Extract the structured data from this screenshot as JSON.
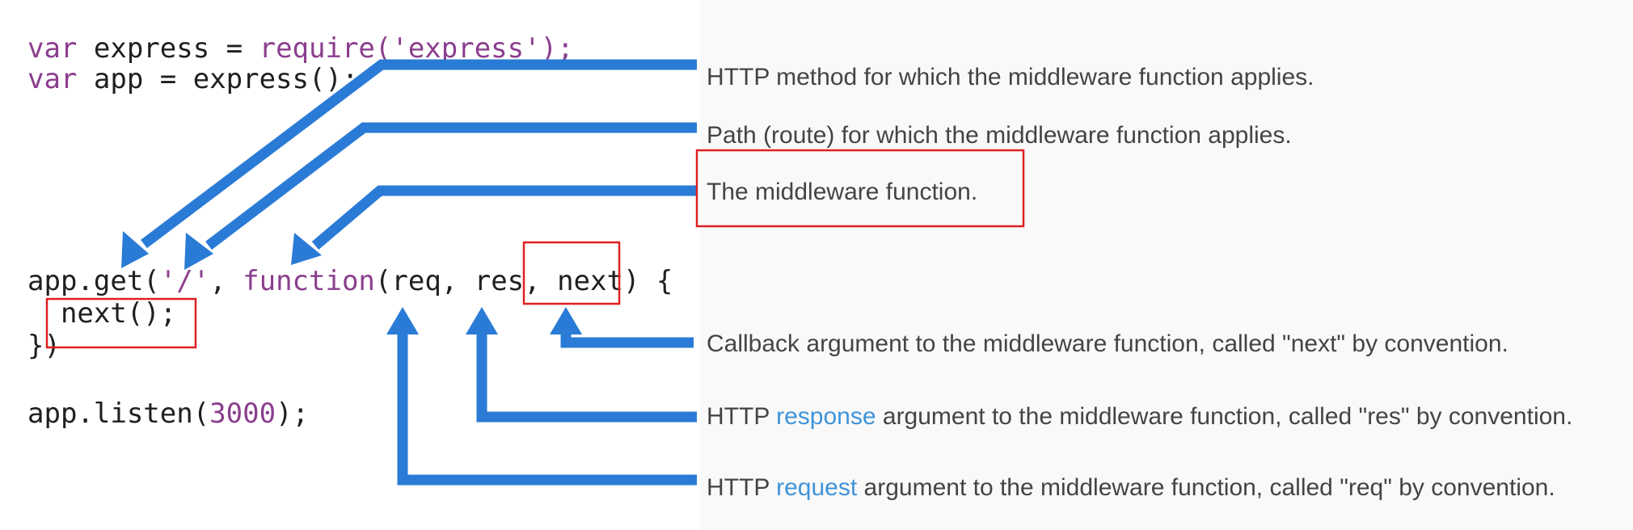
{
  "colors": {
    "arrow": "#2a7bd6",
    "highlight_box": "#e02020",
    "link": "#3f93d9",
    "code_keyword": "#8b3e8e"
  },
  "code": {
    "line1": {
      "kw": "var",
      "rest": " express = ",
      "call": "require(",
      "str": "'express'",
      "end": ");"
    },
    "line2": {
      "kw": "var",
      "rest": " app = express();"
    },
    "line3": {
      "pre": "app.get(",
      "str": "'/'",
      "mid": ", ",
      "fn": "function",
      "args": "(req, res, next) {"
    },
    "line4": "  next();",
    "line5": "})",
    "line6": {
      "pre": "app.listen(",
      "num": "3000",
      "end": ");"
    }
  },
  "annotations": {
    "method": "HTTP method for which the middleware function applies.",
    "path": "Path (route) for which the middleware function applies.",
    "middleware": "The middleware function.",
    "next": "Callback argument to the middleware function, called \"next\" by convention.",
    "res": {
      "pre": "HTTP ",
      "link": "response",
      "post": " argument to the middleware function, called \"res\" by convention."
    },
    "req": {
      "pre": "HTTP ",
      "link": "request",
      "post": " argument to the middleware function, called \"req\" by convention."
    }
  }
}
